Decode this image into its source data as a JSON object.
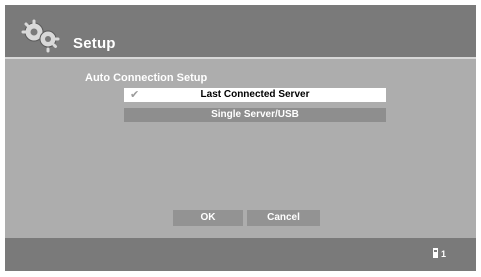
{
  "header": {
    "title": "Setup",
    "icon": "gears-icon"
  },
  "dialog": {
    "section_label": "Auto Connection Setup",
    "options": [
      {
        "label": "Last Connected Server",
        "selected": true
      },
      {
        "label": "Single Server/USB",
        "selected": false
      }
    ],
    "check_mark": "✔",
    "ok_label": "OK",
    "cancel_label": "Cancel"
  },
  "footer": {
    "indicator_icon": "remote-icon",
    "indicator_value": "1"
  },
  "colors": {
    "screen_bg": "#adadad",
    "bar_bg": "#7a7a7a",
    "selected_bg": "#ffffff",
    "option_bg": "#8e8e8e"
  }
}
